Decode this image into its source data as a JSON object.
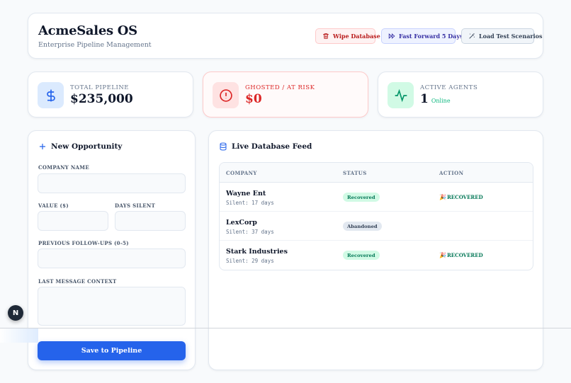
{
  "header": {
    "title": "AcmeSales OS",
    "subtitle": "Enterprise Pipeline Management",
    "buttons": {
      "wipe": "Wipe Database",
      "fast_forward": "Fast Forward 5 Days",
      "load_test": "Load Test Scenarios"
    }
  },
  "stats": {
    "pipeline": {
      "label": "Total Pipeline",
      "value": "$235,000"
    },
    "risk": {
      "label": "Ghosted / At Risk",
      "value": "$0"
    },
    "agents": {
      "label": "Active Agents",
      "value": "1",
      "status": "Online"
    }
  },
  "form": {
    "title": "New Opportunity",
    "company_label": "Company Name",
    "value_label": "Value ($)",
    "days_label": "Days Silent",
    "followups_label": "Previous Follow-ups (0-5)",
    "context_label": "Last Message Context",
    "save_label": "Save to Pipeline"
  },
  "feed": {
    "title": "Live Database Feed",
    "columns": [
      "Company",
      "Status",
      "Action"
    ],
    "rows": [
      {
        "company": "Wayne Ent",
        "silent": "Silent: 17 days",
        "status": "Recovered",
        "action": "RECOVERED"
      },
      {
        "company": "LexCorp",
        "silent": "Silent: 37 days",
        "status": "Abandoned",
        "action": ""
      },
      {
        "company": "Stark Industries",
        "silent": "Silent: 29 days",
        "status": "Recovered",
        "action": "RECOVERED"
      }
    ]
  },
  "overlay": {
    "badge": "N"
  },
  "colors": {
    "primary": "#2563eb",
    "danger": "#dc2626",
    "success": "#10b981"
  }
}
